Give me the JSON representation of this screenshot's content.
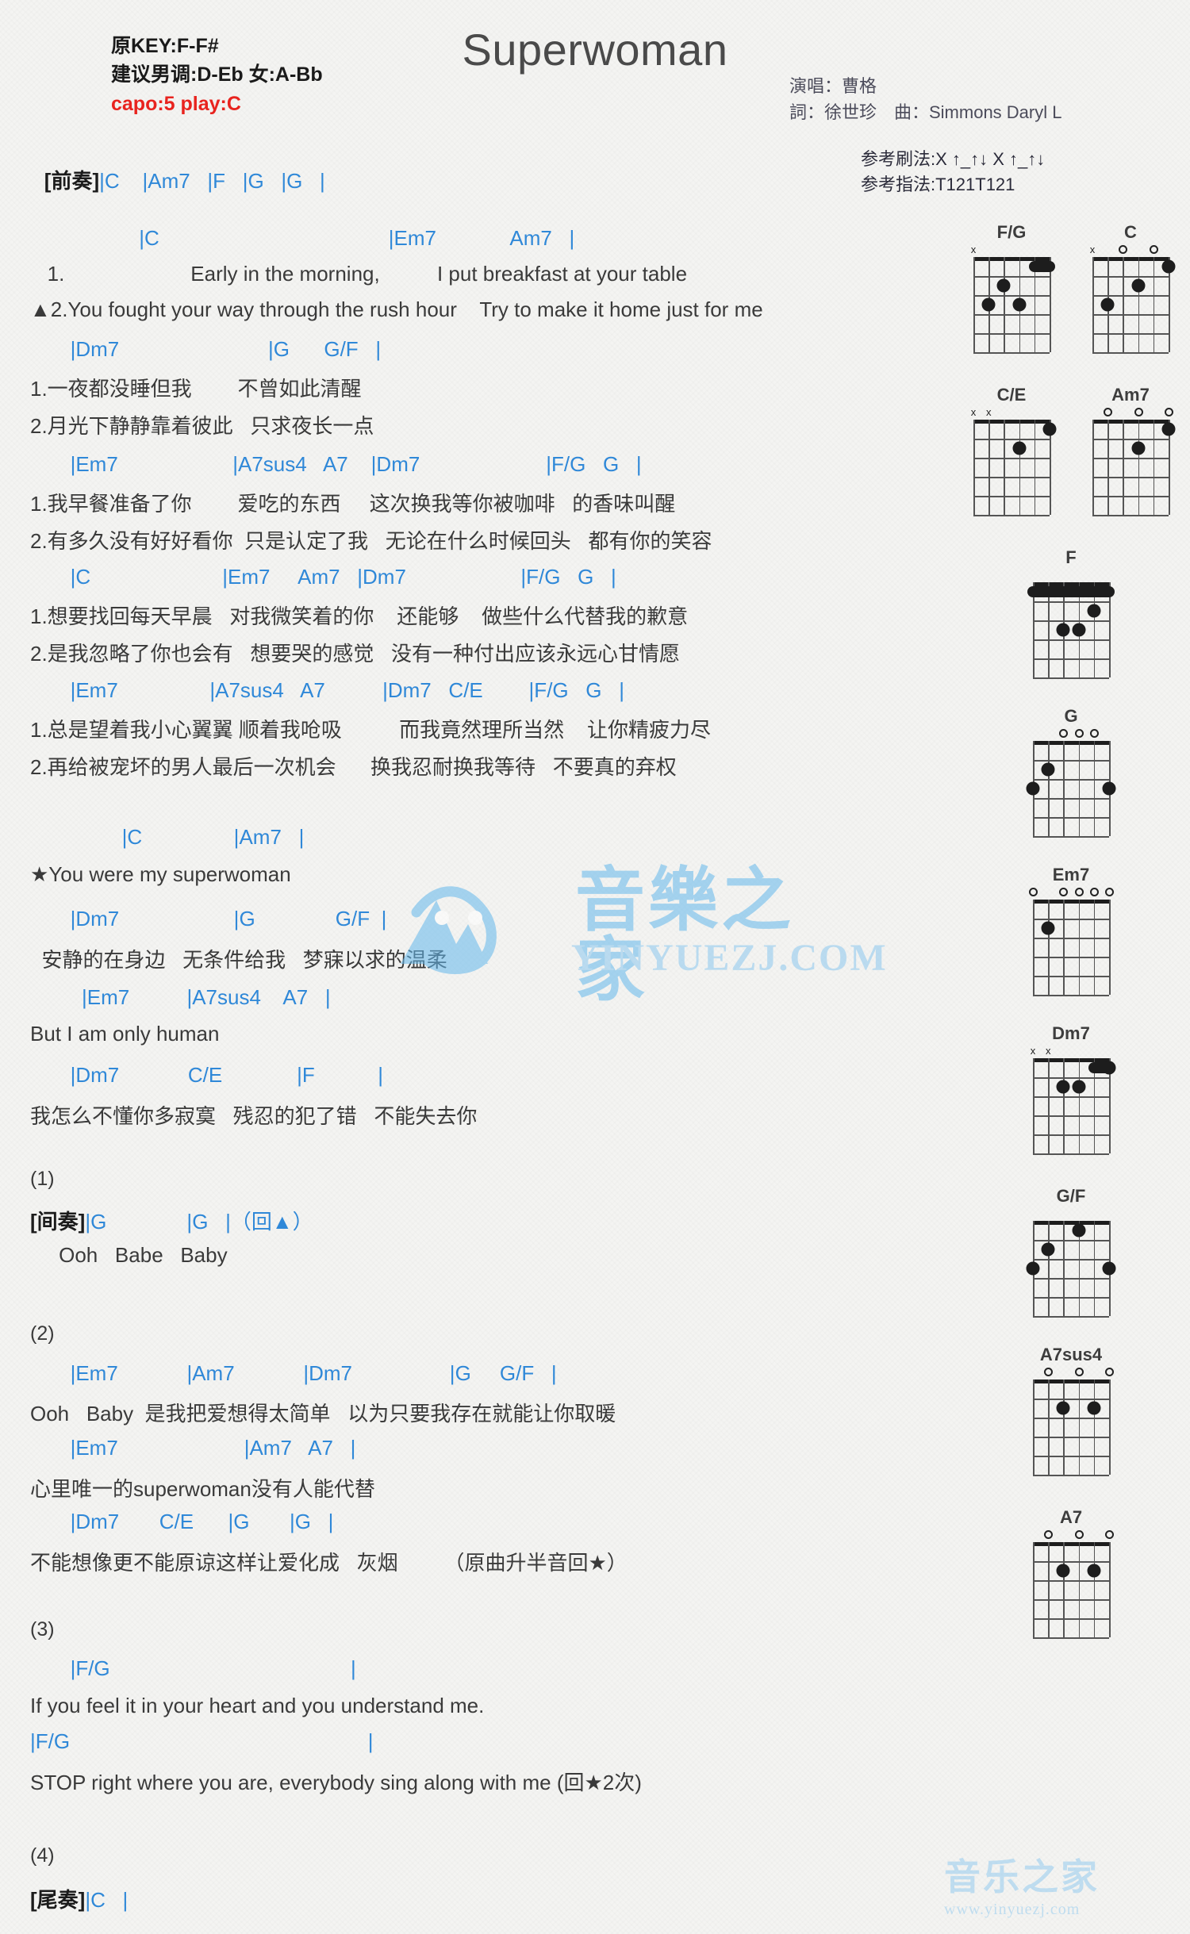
{
  "header": {
    "title": "Superwoman",
    "orig_key": "原KEY:F-F#",
    "suggest_key": "建议男调:D-Eb 女:A-Bb",
    "capo": "capo:5 play:C",
    "singer": "演唱：曹格",
    "writers": "詞：徐世珍　曲：Simmons Daryl L",
    "strum_ref": "参考刷法:X ↑_↑↓ X ↑_↑↓",
    "pick_ref": "参考指法:T121T121",
    "capo_color": "#e8231e",
    "chord_color": "#2f88d8"
  },
  "intro": {
    "tag": "[前奏]",
    "chords": "|C    |Am7   |F   |G   |G   |"
  },
  "verse": [
    {
      "chords": "                   |C                                        |Em7             Am7   |",
      "line1": "   1.                      Early in the morning,          I put breakfast at your table",
      "line2": "▲2.You fought your way through the rush hour    Try to make it home just for me"
    },
    {
      "chords": "       |Dm7                          |G      G/F   |",
      "line1": "1.一夜都没睡但我        不曾如此清醒",
      "line2": "2.月光下静静靠着彼此   只求夜长一点"
    },
    {
      "chords": "       |Em7                    |A7sus4   A7    |Dm7                      |F/G   G   |",
      "line1": "1.我早餐准备了你        爱吃的东西     这次换我等你被咖啡   的香味叫醒",
      "line2": "2.有多久没有好好看你  只是认定了我   无论在什么时候回头   都有你的笑容"
    },
    {
      "chords": "       |C                       |Em7     Am7   |Dm7                    |F/G   G   |",
      "line1": "1.想要找回每天早晨   对我微笑着的你    还能够    做些什么代替我的歉意",
      "line2": "2.是我忽略了你也会有   想要哭的感觉   没有一种付出应该永远心甘情愿"
    },
    {
      "chords": "       |Em7                |A7sus4   A7          |Dm7   C/E        |F/G   G   |",
      "line1": "1.总是望着我小心翼翼 顺着我呛吸          而我竟然理所当然    让你精疲力尽",
      "line2": "2.再给被宠坏的男人最后一次机会      换我忍耐换我等待   不要真的弃权"
    }
  ],
  "chorus": [
    {
      "chords": "                |C                |Am7   |",
      "lyric": "★You were my superwoman"
    },
    {
      "chords": "       |Dm7                    |G              G/F  |",
      "lyric": "  安静的在身边   无条件给我   梦寐以求的温柔"
    },
    {
      "chords": "         |Em7          |A7sus4    A7   |",
      "lyric": "But I am only human"
    },
    {
      "chords": "       |Dm7            C/E             |F           |",
      "lyric": "我怎么不懂你多寂寞   残忍的犯了错   不能失去你"
    }
  ],
  "sections": [
    {
      "number": "(1)",
      "tag": "[间奏]",
      "tag_chords": "|G              |G   |（回▲）",
      "lines": [
        {
          "type": "lyric",
          "text": "     Ooh   Babe   Baby"
        }
      ]
    },
    {
      "number": "(2)",
      "lines": [
        {
          "type": "chord",
          "text": "       |Em7            |Am7            |Dm7                 |G     G/F   |"
        },
        {
          "type": "lyric",
          "text": "Ooh   Baby  是我把爱想得太简单   以为只要我存在就能让你取暖"
        },
        {
          "type": "chord",
          "text": "       |Em7                      |Am7   A7   |"
        },
        {
          "type": "lyric",
          "text": "心里唯一的superwoman没有人能代替"
        },
        {
          "type": "chord",
          "text": "       |Dm7       C/E      |G       |G   |"
        },
        {
          "type": "lyric",
          "text": "不能想像更不能原谅这样让爱化成   灰烟        （原曲升半音回★）"
        }
      ]
    },
    {
      "number": "(3)",
      "lines": [
        {
          "type": "chord",
          "text": "       |F/G                                          |"
        },
        {
          "type": "lyric",
          "text": "If you feel it in your heart and you understand me."
        },
        {
          "type": "chord",
          "text": "|F/G                                                    |"
        },
        {
          "type": "lyric",
          "text": "STOP right where you are, everybody sing along with me (回★2次)"
        }
      ]
    },
    {
      "number": "(4)",
      "tag": "[尾奏]",
      "tag_chords": "|C   |",
      "lines": []
    }
  ],
  "chord_diagrams": [
    {
      "name": "F/G",
      "marks": [
        {
          "type": "x",
          "string": 1
        }
      ],
      "dots": [
        {
          "s": 2,
          "f": 3
        },
        {
          "s": 3,
          "f": 2
        },
        {
          "s": 4,
          "f": 3
        }
      ],
      "barre": {
        "from": 5,
        "to": 6,
        "fret": 1
      }
    },
    {
      "name": "C",
      "marks": [
        {
          "type": "x",
          "string": 1
        },
        {
          "type": "o",
          "string": 3
        },
        {
          "type": "o",
          "string": 5
        }
      ],
      "dots": [
        {
          "s": 2,
          "f": 3
        },
        {
          "s": 4,
          "f": 2
        },
        {
          "s": 6,
          "f": 1
        }
      ],
      "barre": null
    },
    {
      "name": "C/E",
      "marks": [
        {
          "type": "x",
          "string": 1
        },
        {
          "type": "x",
          "string": 2
        }
      ],
      "dots": [
        {
          "s": 4,
          "f": 2
        },
        {
          "s": 6,
          "f": 1
        }
      ],
      "barre": null
    },
    {
      "name": "Am7",
      "marks": [
        {
          "type": "o",
          "string": 2
        },
        {
          "type": "o",
          "string": 4
        },
        {
          "type": "o",
          "string": 6
        }
      ],
      "dots": [
        {
          "s": 4,
          "f": 2
        },
        {
          "s": 6,
          "f": 1
        }
      ],
      "barre": null
    },
    {
      "name": "F",
      "marks": [],
      "dots": [
        {
          "s": 3,
          "f": 3
        },
        {
          "s": 4,
          "f": 3
        },
        {
          "s": 5,
          "f": 2
        }
      ],
      "barre": {
        "from": 1,
        "to": 6,
        "fret": 1
      }
    },
    {
      "name": "G",
      "marks": [
        {
          "type": "o",
          "string": 3
        },
        {
          "type": "o",
          "string": 4
        },
        {
          "type": "o",
          "string": 5
        }
      ],
      "dots": [
        {
          "s": 1,
          "f": 3
        },
        {
          "s": 2,
          "f": 2
        },
        {
          "s": 6,
          "f": 3
        }
      ],
      "barre": null
    },
    {
      "name": "Em7",
      "marks": [
        {
          "type": "o",
          "string": 1
        },
        {
          "type": "o",
          "string": 3
        },
        {
          "type": "o",
          "string": 4
        },
        {
          "type": "o",
          "string": 5
        },
        {
          "type": "o",
          "string": 6
        }
      ],
      "dots": [
        {
          "s": 2,
          "f": 2
        }
      ],
      "barre": null
    },
    {
      "name": "Dm7",
      "marks": [
        {
          "type": "x",
          "string": 1
        },
        {
          "type": "x",
          "string": 2
        }
      ],
      "dots": [
        {
          "s": 3,
          "f": 2
        },
        {
          "s": 4,
          "f": 2
        },
        {
          "s": 6,
          "f": 1
        }
      ],
      "barre": {
        "from": 5,
        "to": 6,
        "fret": 1
      }
    },
    {
      "name": "G/F",
      "marks": [],
      "dots": [
        {
          "s": 1,
          "f": 3
        },
        {
          "s": 2,
          "f": 2
        },
        {
          "s": 4,
          "f": 1
        },
        {
          "s": 6,
          "f": 3
        }
      ],
      "barre": null
    },
    {
      "name": "A7sus4",
      "marks": [
        {
          "type": "o",
          "string": 2
        },
        {
          "type": "o",
          "string": 4
        },
        {
          "type": "o",
          "string": 6
        }
      ],
      "dots": [
        {
          "s": 3,
          "f": 2
        },
        {
          "s": 5,
          "f": 2
        }
      ],
      "barre": null
    },
    {
      "name": "A7",
      "marks": [
        {
          "type": "o",
          "string": 2
        },
        {
          "type": "o",
          "string": 4
        },
        {
          "type": "o",
          "string": 6
        }
      ],
      "dots": [
        {
          "s": 3,
          "f": 2
        },
        {
          "s": 5,
          "f": 2
        }
      ],
      "barre": null
    }
  ],
  "watermark": {
    "cjk": "音樂之家",
    "domain": "YINYUEZJ.COM",
    "bottom_cjk": "音乐之家",
    "bottom_domain": "www.yinyuezj.com"
  }
}
